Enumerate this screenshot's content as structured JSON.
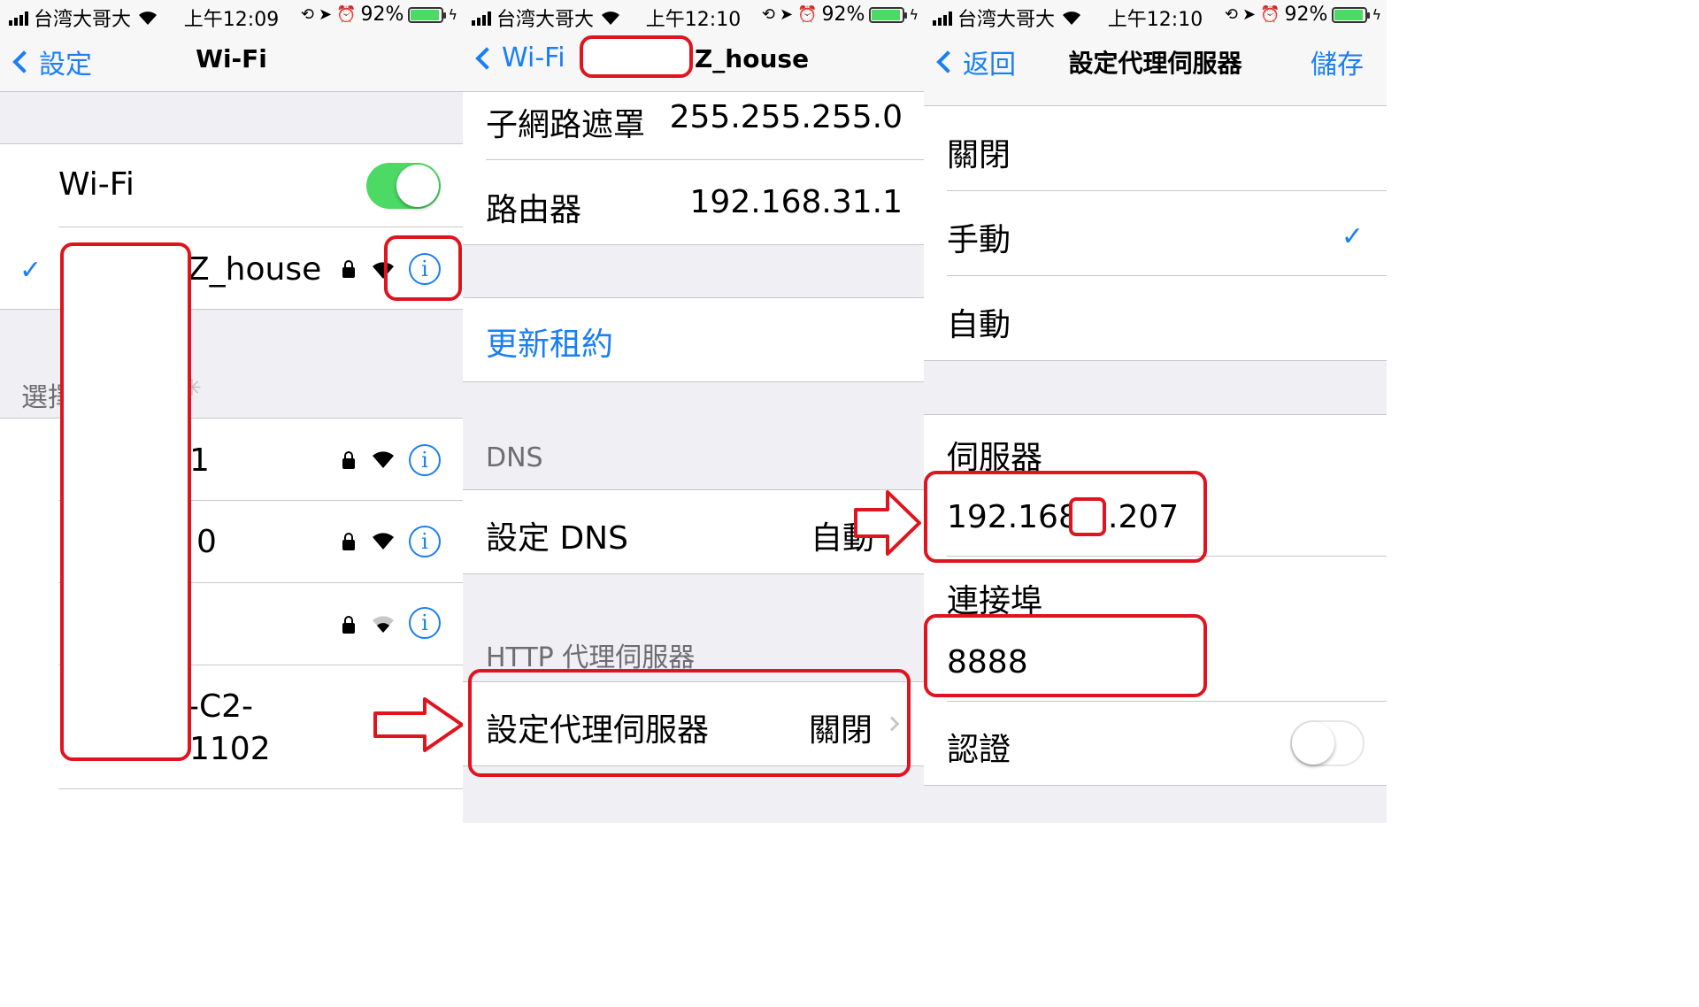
{
  "status": {
    "carrier": "台湾大哥大",
    "battery": "92%",
    "battery_level": 0.92,
    "p1_time": "上午12:09",
    "p2_time": "上午12:10",
    "p3_time": "上午12:10"
  },
  "p1": {
    "back_label": "設定",
    "title": "Wi-Fi",
    "wifi_label": "Wi-Fi",
    "wifi_on": true,
    "connected_network": "Z_house",
    "choose_network_header": "選擇網路...",
    "networks": [
      {
        "name": "1"
      },
      {
        "name": "0"
      },
      {
        "name": ""
      },
      {
        "name_line1": "-C2-",
        "name_line2": "1102"
      }
    ]
  },
  "p2": {
    "back_label": "Wi-Fi",
    "title": "Z_house",
    "subnet_label": "子網路遮罩",
    "subnet_value": "255.255.255.0",
    "router_label": "路由器",
    "router_value": "192.168.31.1",
    "renew_lease": "更新租約",
    "dns_header": "DNS",
    "configure_dns_label": "設定 DNS",
    "configure_dns_value": "自動",
    "http_proxy_header": "HTTP 代理伺服器",
    "configure_proxy_label": "設定代理伺服器",
    "configure_proxy_value": "關閉"
  },
  "p3": {
    "back_label": "返回",
    "title": "設定代理伺服器",
    "save_label": "儲存",
    "options": [
      "關閉",
      "手動",
      "自動"
    ],
    "selected_option": "手動",
    "server_label": "伺服器",
    "server_value_prefix": "192.168.",
    "server_value_suffix": ".207",
    "port_label": "連接埠",
    "port_value": "8888",
    "auth_label": "認證",
    "auth_on": false
  },
  "colors": {
    "ios_blue": "#1a7ef5",
    "toggle_green": "#4cd964",
    "annotation_red": "#e0141e"
  }
}
